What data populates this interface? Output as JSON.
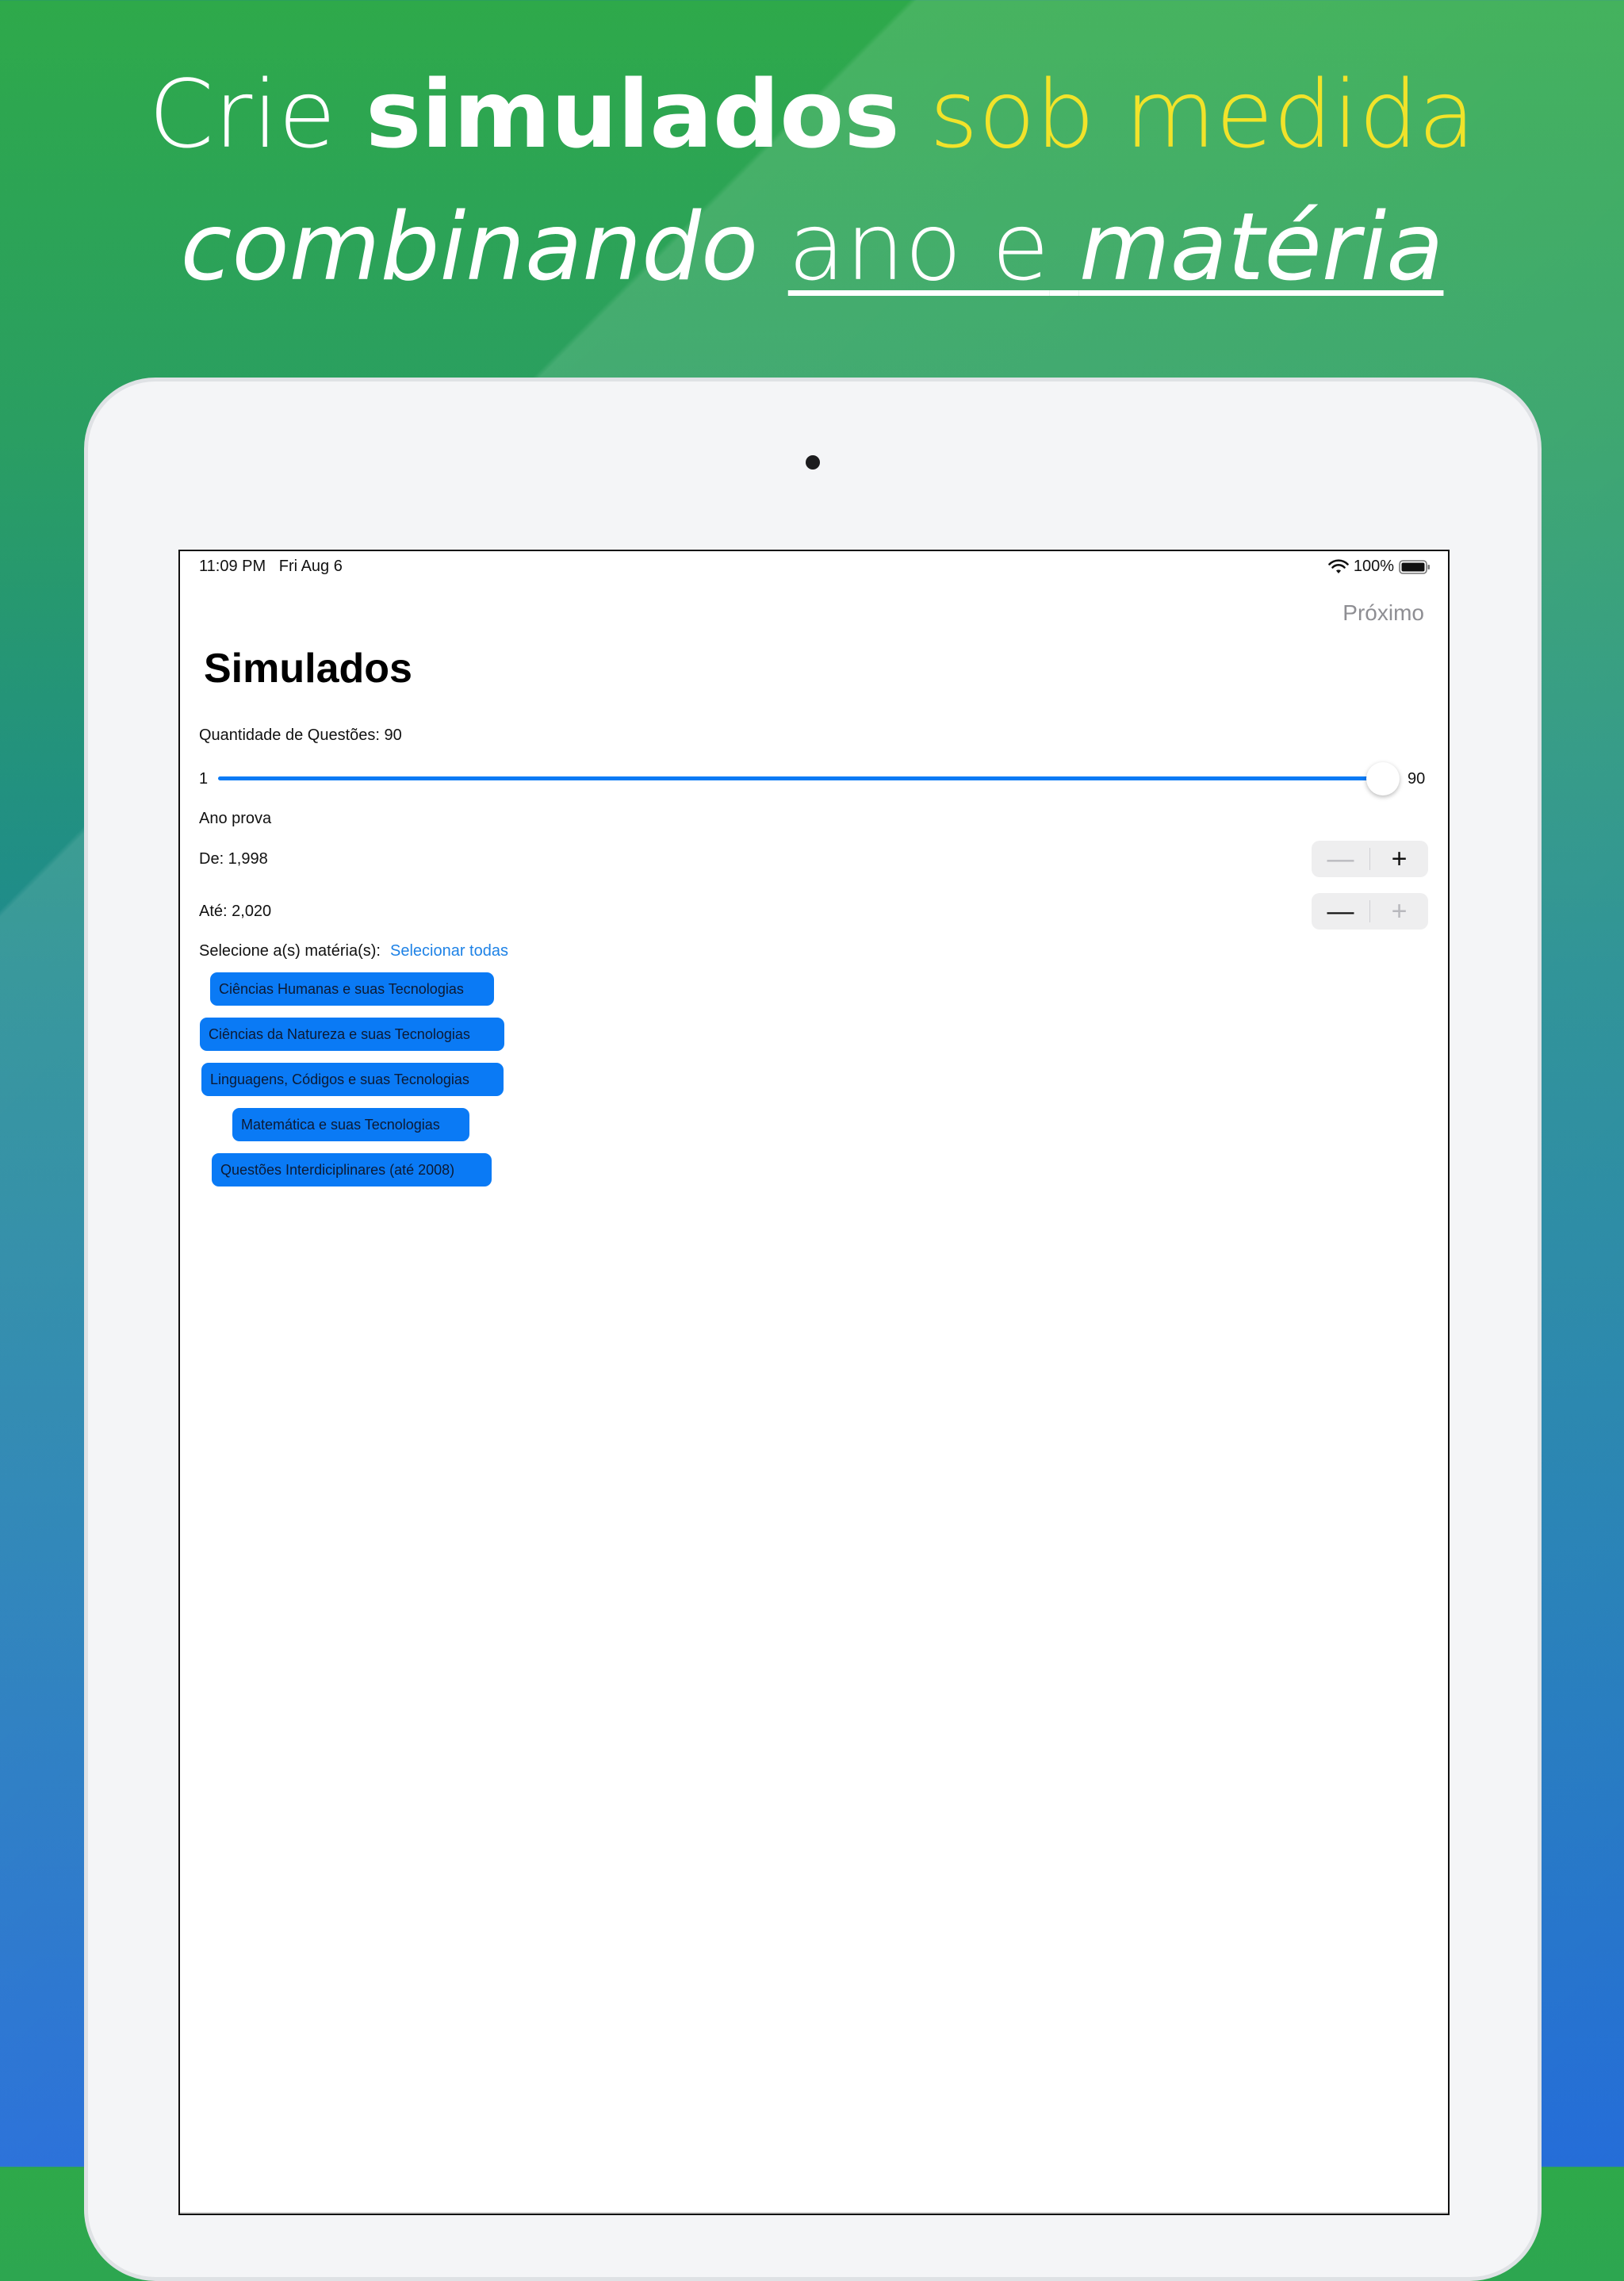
{
  "headline": {
    "line1": {
      "crie": "Crie",
      "simulados": "simulados",
      "sob_medida": "sob medida"
    },
    "line2": {
      "combinando": "combinando",
      "ano_e": "ano e",
      "materia": "matéria"
    }
  },
  "colors": {
    "accent": "#0a7af5",
    "headline_yellow": "#f1e32a",
    "link": "#1e82e6"
  },
  "status_bar": {
    "time": "11:09 PM",
    "date": "Fri Aug 6",
    "battery": "100%"
  },
  "nav": {
    "next_label": "Próximo"
  },
  "page": {
    "title": "Simulados"
  },
  "question_count": {
    "label": "Quantidade de Questões: 90",
    "min_label": "1",
    "max_label": "90",
    "value": 90,
    "min": 1,
    "max": 90
  },
  "year": {
    "section_label": "Ano prova",
    "from_label": "De: 1,998",
    "to_label": "Até: 2,020"
  },
  "subjects": {
    "prompt": "Selecione a(s) matéria(s):",
    "select_all": "Selecionar todas",
    "items": [
      "Ciências Humanas e suas Tecnologias",
      "Ciências da Natureza e suas Tecnologias",
      "Linguagens, Códigos e suas Tecnologias",
      "Matemática e suas Tecnologias",
      "Questões Interdiciplinares (até 2008)"
    ]
  },
  "icons": {
    "minus": "minus-icon",
    "plus": "plus-icon",
    "wifi": "wifi-icon",
    "battery": "battery-icon"
  }
}
